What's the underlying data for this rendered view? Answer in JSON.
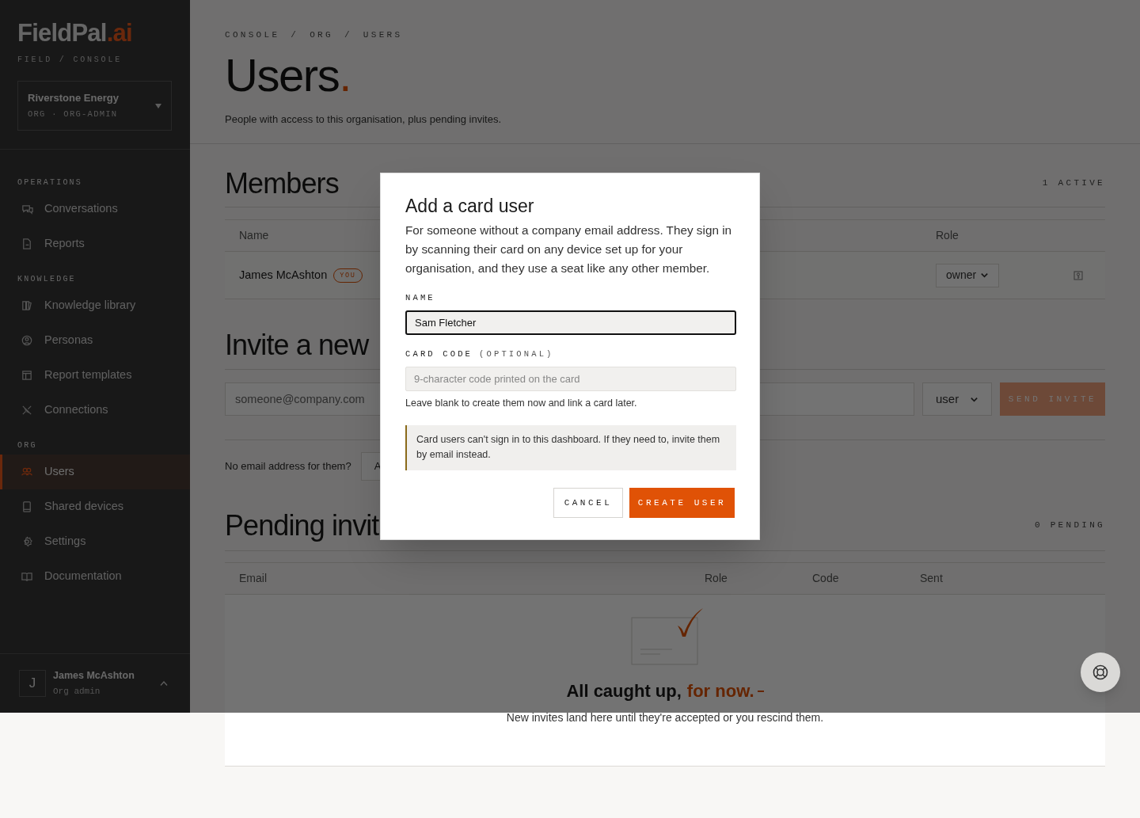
{
  "sidebar": {
    "logo": {
      "name": "FieldPal",
      "suffix": ".ai"
    },
    "tagline": "FIELD / CONSOLE",
    "org_switcher": {
      "name": "Riverstone Energy",
      "detail": "ORG · ORG-ADMIN"
    },
    "sections": [
      {
        "label": "OPERATIONS",
        "items": [
          {
            "label": "Conversations",
            "selected": false
          },
          {
            "label": "Reports",
            "selected": false
          }
        ]
      },
      {
        "label": "KNOWLEDGE",
        "items": [
          {
            "label": "Knowledge library",
            "selected": false
          },
          {
            "label": "Personas",
            "selected": false
          },
          {
            "label": "Report templates",
            "selected": false
          },
          {
            "label": "Connections",
            "selected": false
          }
        ]
      },
      {
        "label": "ORG",
        "items": [
          {
            "label": "Users",
            "selected": true
          },
          {
            "label": "Shared devices",
            "selected": false
          },
          {
            "label": "Settings",
            "selected": false
          },
          {
            "label": "Documentation",
            "selected": false
          }
        ]
      }
    ],
    "user": {
      "initial": "J",
      "name": "James McAshton",
      "role": "Org admin"
    }
  },
  "breadcrumb": {
    "separator": "/",
    "items": [
      "CONSOLE",
      "ORG",
      "USERS"
    ]
  },
  "page": {
    "title": "Users",
    "title_mark": ".",
    "subtitle": "People with access to this organisation, plus pending invites."
  },
  "members": {
    "heading": "Members",
    "count": "1 ACTIVE",
    "columns": [
      "Name",
      "Role"
    ],
    "rows": [
      {
        "name": "James McAshton",
        "badge": "YOU",
        "role": "owner"
      }
    ]
  },
  "invite": {
    "heading": "Invite a new",
    "email_placeholder": "someone@company.com",
    "role": "user",
    "button": "SEND INVITE",
    "disabled": true,
    "alt_prompt": "No email address for them?",
    "alt_button": "A"
  },
  "pending": {
    "heading": "Pending invit",
    "count": "0 PENDING",
    "columns": [
      "Email",
      "Role",
      "Code",
      "Sent"
    ],
    "empty_title": "All caught up,",
    "empty_title_accent": "for now.",
    "empty_text": "New invites land here until they're accepted or you rescind them."
  },
  "modal": {
    "title": "Add a card user",
    "description": "For someone without a company email address. They sign in by scanning their card on any device set up for your organisation, and they use a seat like any other member.",
    "fields": [
      {
        "label": "NAME",
        "value": "Sam Fletcher",
        "focused": true
      },
      {
        "label": "CARD CODE",
        "label_note": "(OPTIONAL)",
        "placeholder": "9-character code printed on the card",
        "focused": false,
        "help": "Leave blank to create them now and link a card later."
      }
    ],
    "notice": "Card users can't sign in to this dashboard. If they need to, invite them by email instead.",
    "buttons": [
      {
        "label": "CANCEL",
        "kind": "secondary"
      },
      {
        "label": "CREATE USER",
        "kind": "primary"
      }
    ]
  }
}
